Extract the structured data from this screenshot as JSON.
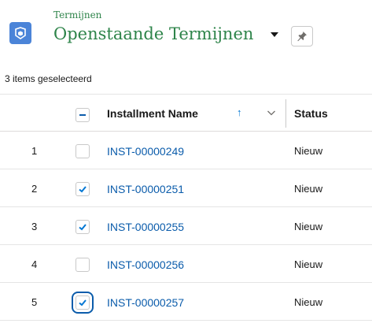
{
  "header": {
    "object_label": "Termijnen",
    "list_title": "Openstaande Termijnen",
    "icon": "installment-object-icon",
    "pin_icon": "pin-icon"
  },
  "selection_info": "3 items geselecteerd",
  "table": {
    "columns": {
      "name": "Installment Name",
      "status": "Status"
    },
    "sort_indicator": "↑",
    "header_checkbox": "indeterminate",
    "rows": [
      {
        "num": "1",
        "name": "INST-00000249",
        "status": "Nieuw",
        "checked": false
      },
      {
        "num": "2",
        "name": "INST-00000251",
        "status": "Nieuw",
        "checked": true
      },
      {
        "num": "3",
        "name": "INST-00000255",
        "status": "Nieuw",
        "checked": true
      },
      {
        "num": "4",
        "name": "INST-00000256",
        "status": "Nieuw",
        "checked": false
      },
      {
        "num": "5",
        "name": "INST-00000257",
        "status": "Nieuw",
        "checked": true
      }
    ]
  },
  "colors": {
    "title_green": "#2e844a",
    "link_blue": "#0b5cab",
    "icon_blue": "#4b84d8",
    "check_blue": "#0176d3"
  }
}
